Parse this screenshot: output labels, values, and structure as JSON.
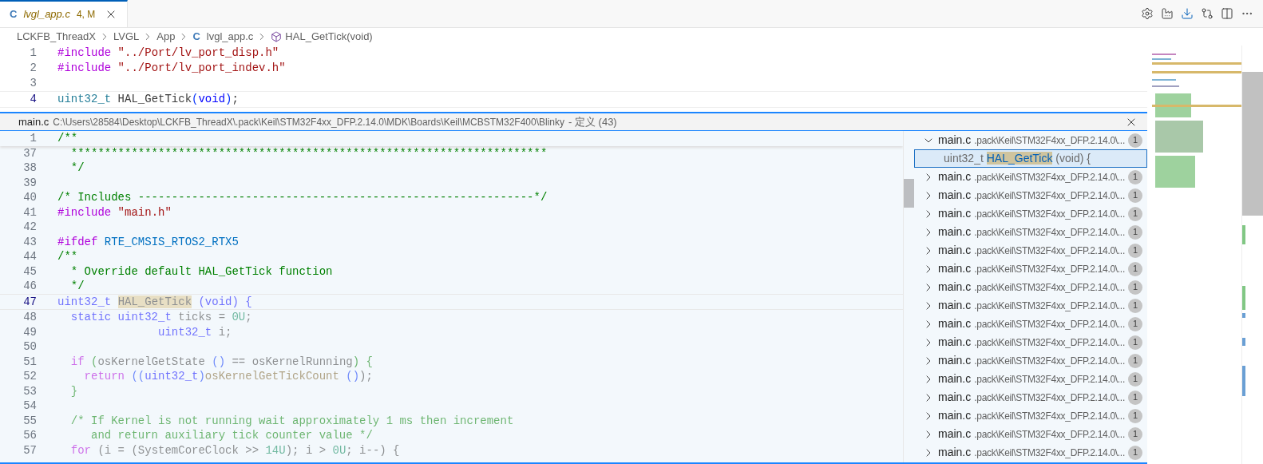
{
  "tabs": [
    {
      "icon_text": "C",
      "label": "lvgl_app.c",
      "status": "4, M",
      "selected": true,
      "preview": true
    }
  ],
  "toolbar": [
    {
      "kind": "settings"
    },
    {
      "kind": "build"
    },
    {
      "kind": "download"
    },
    {
      "kind": "compare"
    },
    {
      "kind": "split"
    },
    {
      "kind": "more"
    }
  ],
  "breadcrumb": [
    {
      "kind": "folder",
      "label": "LCKFB_ThreadX"
    },
    {
      "kind": "folder",
      "label": "LVGL"
    },
    {
      "kind": "folder",
      "label": "App"
    },
    {
      "kind": "file",
      "icon_text": "C",
      "label": "lvgl_app.c"
    },
    {
      "kind": "symbol",
      "label": "HAL_GetTick(void)"
    }
  ],
  "editor": {
    "lines": [
      {
        "number": "1",
        "current": false,
        "tokens": [
          {
            "kind": "preproc",
            "text": "#include"
          },
          {
            "kind": "string",
            "text": " \"../Port/lv_port_disp.h\""
          }
        ]
      },
      {
        "number": "2",
        "current": false,
        "tokens": [
          {
            "kind": "preproc",
            "text": "#include"
          },
          {
            "kind": "string",
            "text": " \"../Port/lv_port_indev.h\""
          }
        ]
      },
      {
        "number": "3",
        "current": false
      },
      {
        "number": "4",
        "current": true,
        "tokens": [
          {
            "kind": "type",
            "text": "uint32_t"
          },
          {
            "kind": "plain",
            "text": " HAL_GetTick"
          },
          {
            "kind": "paren",
            "text": "("
          },
          {
            "kind": "keyword",
            "text": "void"
          },
          {
            "kind": "paren",
            "text": ")"
          },
          {
            "kind": "plain",
            "text": ";"
          }
        ]
      }
    ]
  },
  "peek": {
    "file": "main.c",
    "path": "C:\\Users\\28584\\Desktop\\LCKFB_ThreadX\\.pack\\Keil\\STM32F4xx_DFP.2.14.0\\MDK\\Boards\\Keil\\MCBSTM32F400\\Blinky",
    "suffix": "- 定义 (43)",
    "sticky_lines": [
      {
        "number": "1",
        "tokens": [
          {
            "kind": "comment",
            "text": "/**"
          }
        ]
      }
    ],
    "lines": [
      {
        "number": "37",
        "current": false,
        "inactive": false,
        "tokens": [
          {
            "kind": "comment",
            "text": "  ***********************************************************************"
          }
        ]
      },
      {
        "number": "38",
        "current": false,
        "inactive": false,
        "tokens": [
          {
            "kind": "comment",
            "text": "  */"
          }
        ]
      },
      {
        "number": "39",
        "current": false
      },
      {
        "number": "40",
        "current": false,
        "inactive": false,
        "tokens": [
          {
            "kind": "comment",
            "text": "/* Includes -----------------------------------------------------------*/"
          }
        ]
      },
      {
        "number": "41",
        "current": false,
        "inactive": false,
        "tokens": [
          {
            "kind": "preproc",
            "text": "#include"
          },
          {
            "kind": "string",
            "text": " \"main.h\""
          }
        ]
      },
      {
        "number": "42",
        "current": false
      },
      {
        "number": "43",
        "current": false,
        "inactive": false,
        "tokens": [
          {
            "kind": "preproc",
            "text": "#ifdef"
          },
          {
            "kind": "macro",
            "text": " RTE_CMSIS_RTOS2_RTX5"
          }
        ]
      },
      {
        "number": "44",
        "current": false,
        "inactive": false,
        "tokens": [
          {
            "kind": "comment",
            "text": "/**"
          }
        ]
      },
      {
        "number": "45",
        "current": false,
        "inactive": false,
        "tokens": [
          {
            "kind": "comment",
            "text": "  * Override default HAL_GetTick function"
          }
        ]
      },
      {
        "number": "46",
        "current": false,
        "inactive": false,
        "tokens": [
          {
            "kind": "comment",
            "text": "  */"
          }
        ]
      },
      {
        "number": "47",
        "current": true,
        "inactive": true,
        "tokens": [
          {
            "kind": "keyword",
            "text": "uint32_t "
          },
          {
            "kind": "match",
            "text": "HAL_GetTick"
          },
          {
            "kind": "keyword",
            "text": " (void) {"
          }
        ]
      },
      {
        "number": "48",
        "current": false,
        "inactive": true,
        "tokens": [
          {
            "kind": "keyword",
            "text": "  static uint32_t"
          },
          {
            "kind": "plain",
            "text": " ticks = "
          },
          {
            "kind": "number",
            "text": "0U"
          },
          {
            "kind": "plain",
            "text": ";"
          }
        ]
      },
      {
        "number": "49",
        "current": false,
        "inactive": true,
        "tokens": [
          {
            "kind": "keyword",
            "text": "               uint32_t"
          },
          {
            "kind": "plain",
            "text": " i;"
          }
        ]
      },
      {
        "number": "50",
        "current": false
      },
      {
        "number": "51",
        "current": false,
        "inactive": true,
        "tokens": [
          {
            "kind": "control",
            "text": "  if"
          },
          {
            "kind": "comment",
            "text": " ("
          },
          {
            "kind": "plain",
            "text": "osKernelGetState "
          },
          {
            "kind": "paren",
            "text": "()"
          },
          {
            "kind": "plain",
            "text": " == osKernelRunning"
          },
          {
            "kind": "comment",
            "text": ") {"
          }
        ]
      },
      {
        "number": "52",
        "current": false,
        "inactive": true,
        "tokens": [
          {
            "kind": "control",
            "text": "    return"
          },
          {
            "kind": "paren",
            "text": " (("
          },
          {
            "kind": "keyword",
            "text": "uint32_t"
          },
          {
            "kind": "paren",
            "text": ")"
          },
          {
            "kind": "fn",
            "text": "osKernelGetTickCount "
          },
          {
            "kind": "paren",
            "text": "()"
          },
          {
            "kind": "plain",
            "text": ");"
          }
        ]
      },
      {
        "number": "53",
        "current": false,
        "inactive": true,
        "tokens": [
          {
            "kind": "comment",
            "text": "  }"
          }
        ]
      },
      {
        "number": "54",
        "current": false
      },
      {
        "number": "55",
        "current": false,
        "inactive": true,
        "tokens": [
          {
            "kind": "comment",
            "text": "  /* If Kernel is not running wait approximately 1 ms then increment"
          }
        ]
      },
      {
        "number": "56",
        "current": false,
        "inactive": true,
        "tokens": [
          {
            "kind": "comment",
            "text": "     and return auxiliary tick counter value */"
          }
        ]
      },
      {
        "number": "57",
        "current": false,
        "inactive": true,
        "tokens": [
          {
            "kind": "control",
            "text": "  for"
          },
          {
            "kind": "plain",
            "text": " (i = (SystemCoreClock >> "
          },
          {
            "kind": "number",
            "text": "14U"
          },
          {
            "kind": "plain",
            "text": "); i > "
          },
          {
            "kind": "number",
            "text": "0U"
          },
          {
            "kind": "plain",
            "text": "; i--) {"
          }
        ]
      }
    ],
    "references": [
      {
        "file": "main.c",
        "path": ".pack\\Keil\\STM32F4xx_DFP.2.14.0\\...",
        "count": "1",
        "expanded": true,
        "children": [
          {
            "selected": true,
            "tokens": [
              {
                "kind": "dim",
                "text": "uint32_t "
              },
              {
                "kind": "match",
                "text": "HAL_GetTick"
              },
              {
                "kind": "dim",
                "text": " (void) {"
              }
            ]
          }
        ]
      },
      {
        "file": "main.c",
        "path": ".pack\\Keil\\STM32F4xx_DFP.2.14.0\\...",
        "count": "1",
        "expanded": false
      },
      {
        "file": "main.c",
        "path": ".pack\\Keil\\STM32F4xx_DFP.2.14.0\\...",
        "count": "1",
        "expanded": false
      },
      {
        "file": "main.c",
        "path": ".pack\\Keil\\STM32F4xx_DFP.2.14.0\\...",
        "count": "1",
        "expanded": false
      },
      {
        "file": "main.c",
        "path": ".pack\\Keil\\STM32F4xx_DFP.2.14.0\\...",
        "count": "1",
        "expanded": false
      },
      {
        "file": "main.c",
        "path": ".pack\\Keil\\STM32F4xx_DFP.2.14.0\\...",
        "count": "1",
        "expanded": false
      },
      {
        "file": "main.c",
        "path": ".pack\\Keil\\STM32F4xx_DFP.2.14.0\\...",
        "count": "1",
        "expanded": false
      },
      {
        "file": "main.c",
        "path": ".pack\\Keil\\STM32F4xx_DFP.2.14.0\\...",
        "count": "1",
        "expanded": false
      },
      {
        "file": "main.c",
        "path": ".pack\\Keil\\STM32F4xx_DFP.2.14.0\\...",
        "count": "1",
        "expanded": false
      },
      {
        "file": "main.c",
        "path": ".pack\\Keil\\STM32F4xx_DFP.2.14.0\\...",
        "count": "1",
        "expanded": false
      },
      {
        "file": "main.c",
        "path": ".pack\\Keil\\STM32F4xx_DFP.2.14.0\\...",
        "count": "1",
        "expanded": false
      },
      {
        "file": "main.c",
        "path": ".pack\\Keil\\STM32F4xx_DFP.2.14.0\\...",
        "count": "1",
        "expanded": false
      },
      {
        "file": "main.c",
        "path": ".pack\\Keil\\STM32F4xx_DFP.2.14.0\\...",
        "count": "1",
        "expanded": false
      },
      {
        "file": "main.c",
        "path": ".pack\\Keil\\STM32F4xx_DFP.2.14.0\\...",
        "count": "1",
        "expanded": false
      },
      {
        "file": "main.c",
        "path": ".pack\\Keil\\STM32F4xx_DFP.2.14.0\\...",
        "count": "1",
        "expanded": false
      },
      {
        "file": "main.c",
        "path": ".pack\\Keil\\STM32F4xx_DFP.2.14.0\\...",
        "count": "1",
        "expanded": false
      },
      {
        "file": "main.c",
        "path": ".pack\\Keil\\STM32F4xx_DFP.2.14.0\\...",
        "count": "1",
        "expanded": false
      }
    ]
  }
}
